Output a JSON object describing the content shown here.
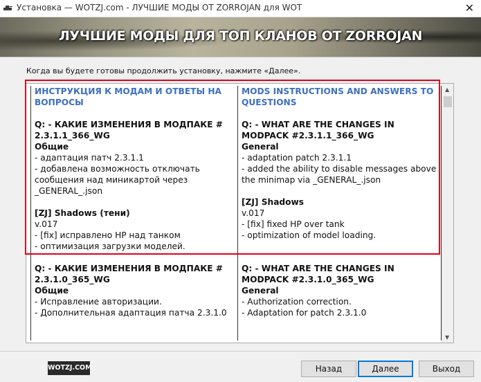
{
  "window": {
    "title": "Установка — WOTZJ.com - ЛУЧШИЕ МОДЫ ОТ ZORROJAN для WOT",
    "close_glyph": "✕"
  },
  "banner": {
    "title": "ЛУЧШИЕ МОДЫ ДЛЯ ТОП КЛАНОВ ОТ ZORROJAN"
  },
  "instruction": "Когда вы будете готовы продолжить установку, нажмите «Далее».",
  "content": {
    "ru": {
      "header": "ИНСТРУКЦИЯ К МОДАМ И ОТВЕТЫ НА ВОПРОСЫ",
      "s1_q": "Q: - КАКИЕ ИЗМЕНЕНИЯ В МОДПАКЕ # 2.3.1.1_366_WG",
      "s1_sub": "Общие",
      "s1_l1": "- адаптация патч 2.3.1.1",
      "s1_l2": "- добавлена возможность отключать сообщения над миникартой через _GENERAL_.json",
      "s2_title": "[ZJ] Shadows (тени)",
      "s2_ver": "v.017",
      "s2_l1": "- [fix] исправлено HP над танком",
      "s2_l2": "- оптимизация загрузки моделей.",
      "s3_q": "Q: - КАКИЕ ИЗМЕНЕНИЯ В МОДПАКЕ # 2.3.1.0_365_WG",
      "s3_sub": "Общие",
      "s3_l1": "- Исправление авторизации.",
      "s3_l2": "- Дополнительная адаптация патча 2.3.1.0"
    },
    "en": {
      "header": "MODS INSTRUCTIONS AND ANSWERS TO QUESTIONS",
      "s1_q": "Q: - WHAT ARE THE CHANGES IN MODPACK #2.3.1.1_366_WG",
      "s1_sub": "General",
      "s1_l1": "- adaptation patch 2.3.1.1",
      "s1_l2": "- added the ability to disable messages above the minimap via _GENERAL_.json",
      "s2_title": "[ZJ] Shadows",
      "s2_ver": "v.017",
      "s2_l1": "- [fix] fixed HP over tank",
      "s2_l2": "- optimization of model loading.",
      "s3_q": "Q: - WHAT ARE THE CHANGES IN MODPACK #2.3.1.0_365_WG",
      "s3_sub": "General",
      "s3_l1": "- Authorization correction.",
      "s3_l2": "- Adaptation for patch 2.3.1.0"
    }
  },
  "footer": {
    "logo": "WOTZJ.COM",
    "back": "Назад",
    "next": "Далее",
    "exit": "Выход"
  },
  "colors": {
    "header_blue": "#3c6fbf",
    "highlight_red": "#e0001a",
    "primary_border": "#0078d7"
  },
  "icons": {
    "app": "tank-icon",
    "close": "close-icon",
    "scroll_up": "chevron-up-icon",
    "scroll_down": "chevron-down-icon"
  }
}
